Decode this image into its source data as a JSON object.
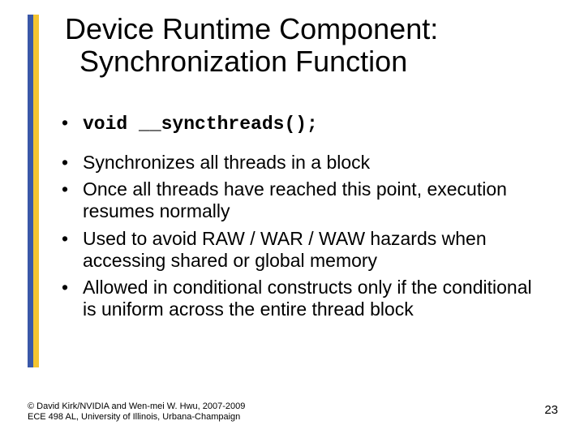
{
  "title_line1": "Device Runtime Component:",
  "title_line2": "Synchronization Function",
  "bullets": {
    "b0": "void __syncthreads();",
    "b1": "Synchronizes all threads in a block",
    "b2": "Once all threads have reached this point, execution resumes normally",
    "b3": "Used to avoid RAW / WAR / WAW hazards when accessing shared or global memory",
    "b4": "Allowed in conditional constructs only if the conditional is uniform across the entire thread block"
  },
  "footer_line1": "© David Kirk/NVIDIA and Wen-mei W. Hwu, 2007-2009",
  "footer_line2": "ECE 498 AL, University of Illinois, Urbana-Champaign",
  "page_number": "23"
}
